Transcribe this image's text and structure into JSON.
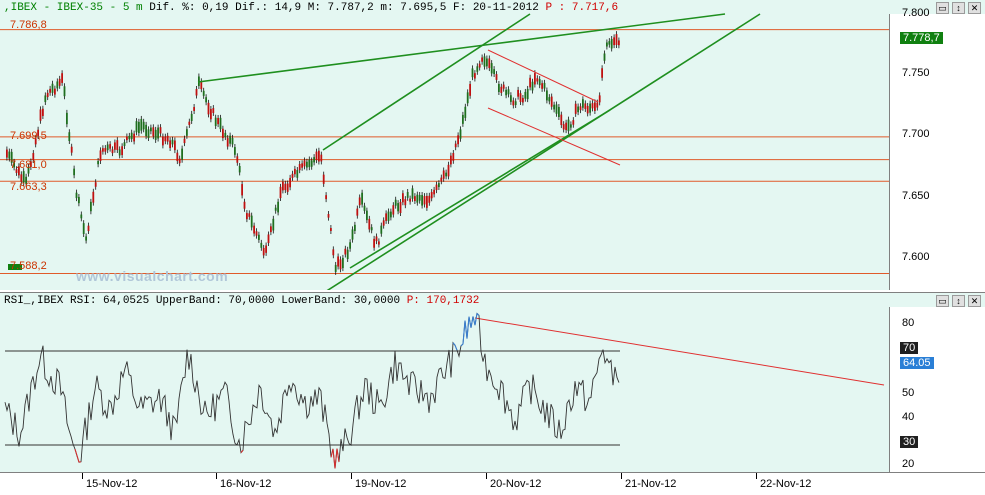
{
  "price_pane": {
    "header": {
      "prefix": ",IBEX - IBEX-35 - ",
      "period": "5 m",
      "dif_pct_label": "Dif. %:",
      "dif_pct": "0,19",
      "dif_label": "Dif.:",
      "dif": "14,9",
      "max_label": "M:",
      "max": "7.787,2",
      "min_label": "m:",
      "min": "7.695,5",
      "date_label": "F:",
      "date": "20-11-2012",
      "last_label": "P :",
      "last": "7.717,6"
    },
    "y_ticks": [
      "7.800",
      "7.750",
      "7.700",
      "7.650",
      "7.600"
    ],
    "last_price_tag": "7.778,7",
    "levels": [
      "7.786,8",
      "7.699,5",
      "7.681,0",
      "7.663,3",
      "7.588,2"
    ],
    "watermark": "www.visualchart.com"
  },
  "rsi_pane": {
    "header": {
      "text": "RSI_,IBEX RSI: 64,0525 UpperBand: 70,0000 LowerBand: 30,0000",
      "p_label": "P:",
      "p": "170,1732"
    },
    "y_ticks": [
      "80",
      "70",
      "60",
      "50",
      "40",
      "30",
      "20"
    ],
    "upper_tag": "70",
    "value_tag": "64.05",
    "lower_tag": "30"
  },
  "time_axis": {
    "dates": [
      "15-Nov-12",
      "16-Nov-12",
      "19-Nov-12",
      "20-Nov-12",
      "21-Nov-12",
      "22-Nov-12"
    ]
  },
  "window_buttons": [
    "▭",
    "↕",
    "✕"
  ],
  "colors": {
    "pane_bg": "#e4f7f2",
    "level_line": "#e05a2a",
    "trend_line": "#1f8f1f",
    "channel_line": "#e03030",
    "bull_candle": "#1f6f1f",
    "bear_candle": "#c01010",
    "rsi_line": "#333333",
    "rsi_overbought": "#3a7fd0",
    "rsi_oversold": "#d03030",
    "tag_green": "#108010",
    "tag_blue": "#2a7fd6",
    "tag_dark": "#202020"
  }
}
